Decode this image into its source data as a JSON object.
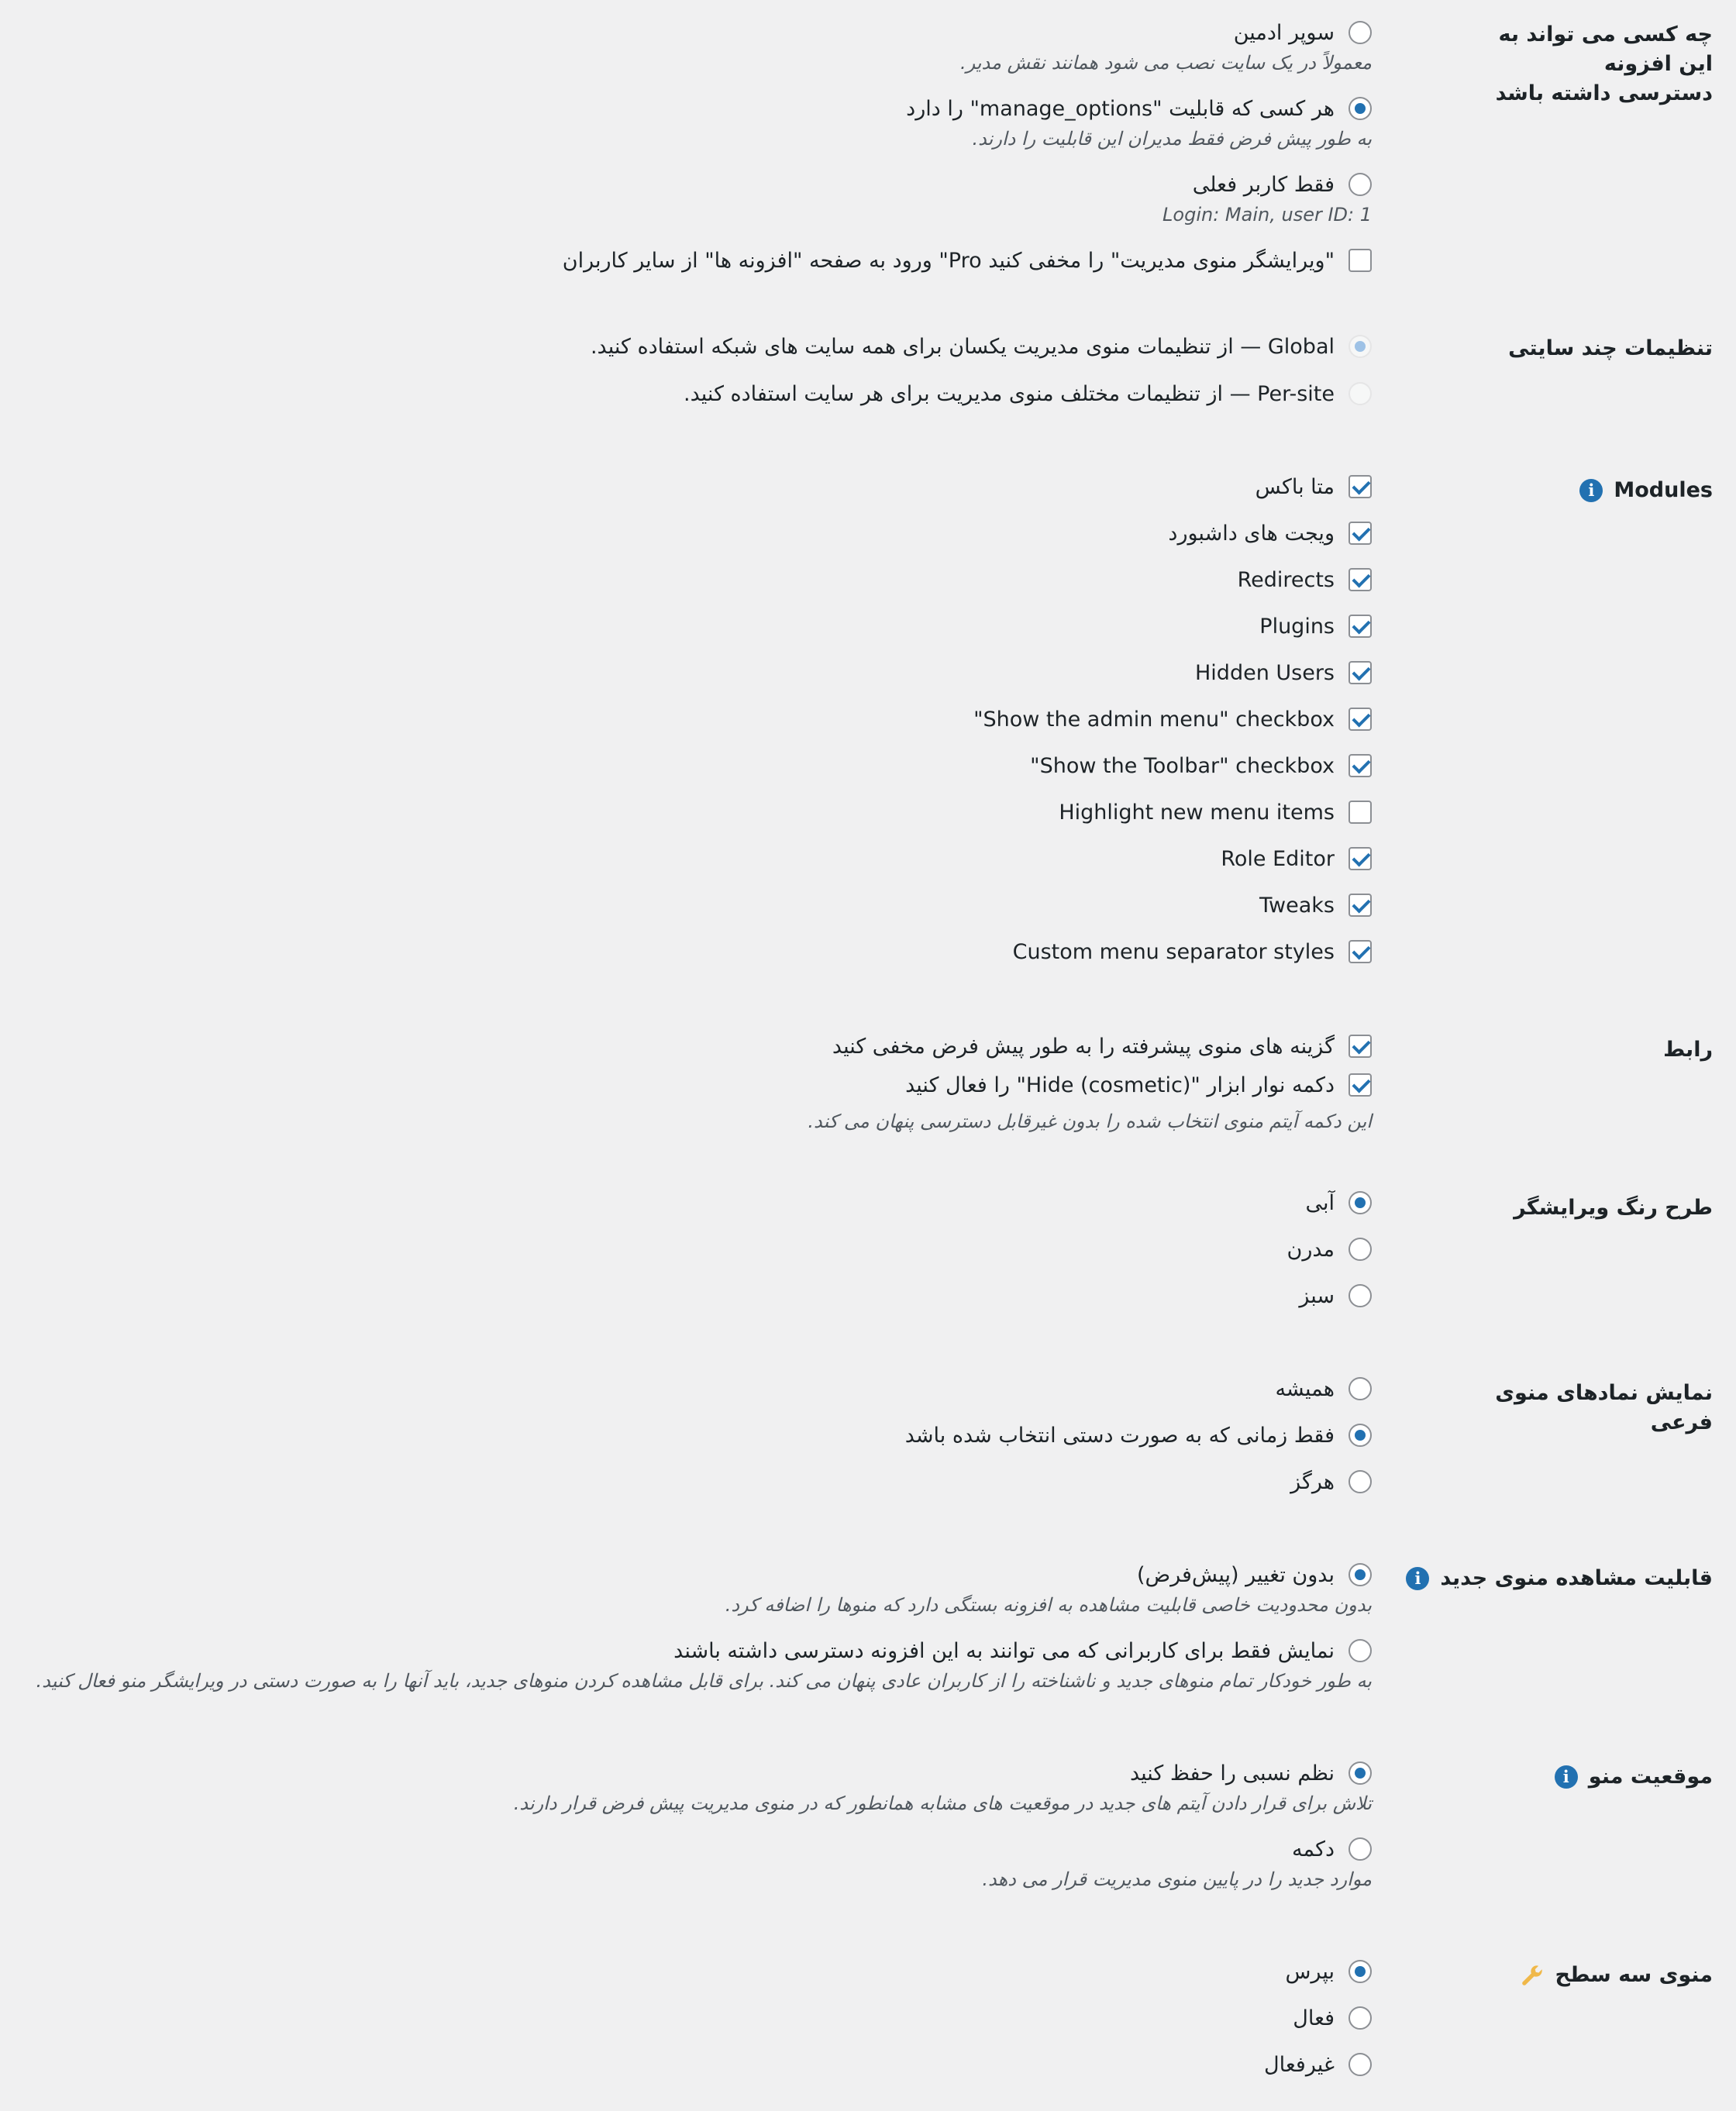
{
  "sections": {
    "access": {
      "title_line1": "چه کسی می تواند به این افزونه",
      "title_line2": "دسترسی داشته باشد",
      "options": [
        {
          "label": "سوپر ادمین",
          "desc": "معمولاً در یک سایت نصب می شود همانند نقش مدیر.",
          "selected": false
        },
        {
          "label": "هر کسی که قابلیت \"manage_options\" را دارد",
          "desc": "به طور پیش فرض فقط مدیران این قابلیت را دارند.",
          "selected": true
        },
        {
          "label": "فقط کاربر فعلی",
          "desc": "Login: Main, user ID: 1",
          "selected": false
        }
      ],
      "hide_pro_checkbox": {
        "label": "\"ویرایشگر منوی مدیریت\" را مخفی کنید Pro\" ورود به صفحه \"افزونه ها\" از سایر کاربران",
        "checked": false
      }
    },
    "multisite": {
      "title": "تنظیمات چند سایتی",
      "options": [
        {
          "label": "Global — از تنظیمات منوی مدیریت یکسان برای همه سایت های شبکه استفاده کنید.",
          "selected": true
        },
        {
          "label": "Per-site — از تنظیمات مختلف منوی مدیریت برای هر سایت استفاده کنید.",
          "selected": false
        }
      ]
    },
    "modules": {
      "title": "Modules",
      "icon": "info-icon",
      "items": [
        {
          "label": "متا باکس",
          "checked": true
        },
        {
          "label": "ویجت های داشبورد",
          "checked": true
        },
        {
          "label": "Redirects",
          "checked": true
        },
        {
          "label": "Plugins",
          "checked": true
        },
        {
          "label": "Hidden Users",
          "checked": true
        },
        {
          "label": "Show the admin menu\" checkbox\"",
          "checked": true
        },
        {
          "label": "Show the Toolbar\" checkbox\"",
          "checked": true
        },
        {
          "label": "Highlight new menu items",
          "checked": false
        },
        {
          "label": "Role Editor",
          "checked": true
        },
        {
          "label": "Tweaks",
          "checked": true
        },
        {
          "label": "Custom menu separator styles",
          "checked": true
        }
      ]
    },
    "interface": {
      "title": "رابط",
      "items": [
        {
          "label": "گزینه های منوی پیشرفته را به طور پیش فرض مخفی کنید",
          "checked": true
        },
        {
          "label": "دکمه نوار ابزار \"Hide (cosmetic)\" را فعال کنید",
          "checked": true
        }
      ],
      "desc": "این دکمه آیتم منوی انتخاب شده را بدون غیرقابل دسترسی پنهان می کند."
    },
    "color_scheme": {
      "title": "طرح رنگ ویرایشگر",
      "options": [
        {
          "label": "آبی",
          "selected": true
        },
        {
          "label": "مدرن",
          "selected": false
        },
        {
          "label": "سبز",
          "selected": false
        }
      ]
    },
    "submenu_icons": {
      "title": "نمایش نمادهای منوی فرعی",
      "options": [
        {
          "label": "همیشه",
          "selected": false
        },
        {
          "label": "فقط زمانی که به صورت دستی انتخاب شده باشد",
          "selected": true
        },
        {
          "label": "هرگز",
          "selected": false
        }
      ]
    },
    "new_menu_visibility": {
      "title": "قابلیت مشاهده منوی جدید",
      "icon": "info-icon",
      "options": [
        {
          "label": "بدون تغییر (پیش‌فرض)",
          "desc": "بدون محدودیت خاصی قابلیت مشاهده به افزونه بستگی دارد که منوها را اضافه کرد.",
          "selected": true
        },
        {
          "label": "نمایش فقط برای کاربرانی که می توانند به این افزونه دسترسی داشته باشند",
          "desc": "به طور خودکار تمام منوهای جدید و ناشناخته را از کاربران عادی پنهان می کند. برای قابل مشاهده کردن منوهای جدید، باید آنها را به صورت دستی در ویرایشگر منو فعال کنید.",
          "selected": false
        }
      ]
    },
    "menu_position": {
      "title": "موقعیت منو",
      "icon": "info-icon",
      "options": [
        {
          "label": "نظم نسبی را حفظ کنید",
          "desc": "تلاش برای قرار دادن آیتم های جدید در موقعیت های مشابه همانطور که در منوی مدیریت پیش فرض قرار دارند.",
          "selected": true
        },
        {
          "label": "دکمه",
          "desc": "موارد جدید را در پایین منوی مدیریت قرار می دهد.",
          "selected": false
        }
      ]
    },
    "three_level": {
      "title": "منوی سه سطح",
      "icon": "wrench-icon",
      "options": [
        {
          "label": "بپرس",
          "selected": true
        },
        {
          "label": "فعال",
          "selected": false
        },
        {
          "label": "غیرفعال",
          "selected": false
        }
      ]
    }
  }
}
